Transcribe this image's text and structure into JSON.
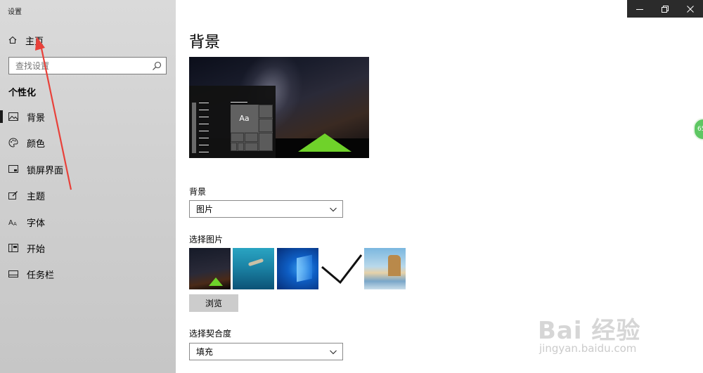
{
  "window": {
    "title": "设置",
    "controls": [
      "minimize-icon",
      "restore-icon",
      "close-icon"
    ]
  },
  "sidebar": {
    "home_label": "主页",
    "search_placeholder": "查找设置",
    "section_title": "个性化",
    "items": [
      {
        "label": "背景",
        "icon": "picture-icon",
        "active": true
      },
      {
        "label": "颜色",
        "icon": "palette-icon",
        "active": false
      },
      {
        "label": "锁屏界面",
        "icon": "lockscreen-icon",
        "active": false
      },
      {
        "label": "主题",
        "icon": "theme-icon",
        "active": false
      },
      {
        "label": "字体",
        "icon": "font-icon",
        "active": false
      },
      {
        "label": "开始",
        "icon": "start-icon",
        "active": false
      },
      {
        "label": "任务栏",
        "icon": "taskbar-icon",
        "active": false
      }
    ]
  },
  "main": {
    "title": "背景",
    "preview": {
      "tile_text": "Aa"
    },
    "background_label": "背景",
    "background_value": "图片",
    "choose_picture_label": "选择图片",
    "thumbnails": [
      "night-sky-tent",
      "underwater-swimmer",
      "windows-logo",
      "blank-selected",
      "beach-rock"
    ],
    "browse_label": "浏览",
    "fit_label": "选择契合度",
    "fit_value": "填充"
  },
  "badge": {
    "text": "65"
  },
  "watermark": {
    "main": "Bai 经验",
    "sub": "jingyan.baidu.com"
  },
  "colors": {
    "sidebar_bg": "#d4d4d4",
    "accent_green": "#6fd22a",
    "annotation_red": "#e8413a"
  }
}
